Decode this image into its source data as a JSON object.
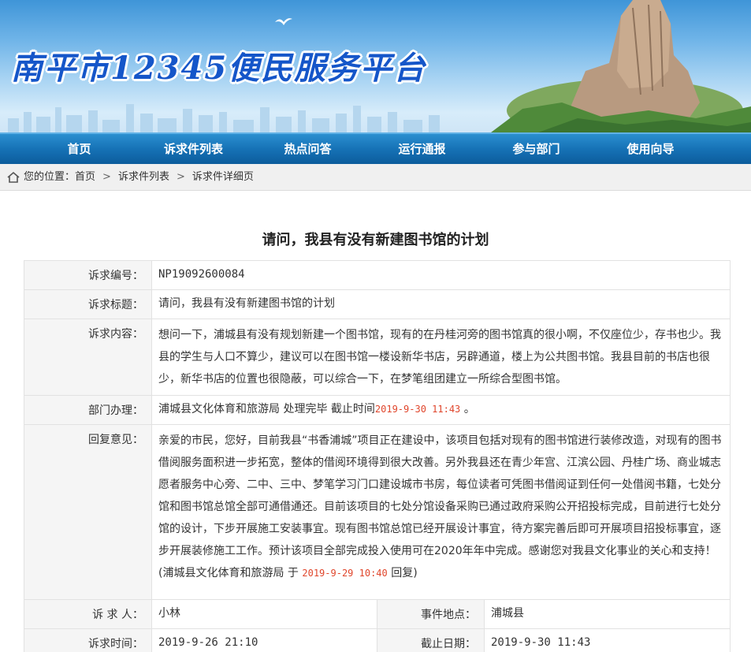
{
  "header": {
    "site_title": "南平市12345便民服务平台"
  },
  "nav": {
    "items": [
      {
        "label": "首页"
      },
      {
        "label": "诉求件列表"
      },
      {
        "label": "热点问答"
      },
      {
        "label": "运行通报"
      },
      {
        "label": "参与部门"
      },
      {
        "label": "使用向导"
      }
    ]
  },
  "breadcrumb": {
    "prefix": "您的位置：",
    "items": [
      "首页",
      "诉求件列表",
      "诉求件详细页"
    ],
    "separator": ">"
  },
  "page": {
    "title": "请问，我县有没有新建图书馆的计划"
  },
  "detail": {
    "id_label": "诉求编号：",
    "id_value": "NP19092600084",
    "title_label": "诉求标题：",
    "title_value": "请问，我县有没有新建图书馆的计划",
    "content_label": "诉求内容：",
    "content_value": "想问一下，浦城县有没有规划新建一个图书馆，现有的在丹桂河旁的图书馆真的很小啊，不仅座位少，存书也少。我县的学生与人口不算少，建议可以在图书馆一楼设新华书店，另辟通道，楼上为公共图书馆。我县目前的书店也很少，新华书店的位置也很隐蔽，可以综合一下，在梦笔组团建立一所综合型图书馆。",
    "dept_label": "部门办理：",
    "dept_prefix": "浦城县文化体育和旅游局 处理完毕  截止时间",
    "dept_deadline": "2019-9-30 11:43",
    "dept_suffix": " 。",
    "reply_label": "回复意见：",
    "reply_value": "亲爱的市民，您好，目前我县“书香浦城”项目正在建设中，该项目包括对现有的图书馆进行装修改造，对现有的图书借阅服务面积进一步拓宽，整体的借阅环境得到很大改善。另外我县还在青少年宫、江滨公园、丹桂广场、商业城志愿者服务中心旁、二中、三中、梦笔学习门口建设城市书房，每位读者可凭图书借阅证到任何一处借阅书籍，七处分馆和图书馆总馆全部可通借通还。目前该项目的七处分馆设备采购已通过政府采购公开招投标完成，目前进行七处分馆的设计，下步开展施工安装事宜。现有图书馆总馆已经开展设计事宜，待方案完善后即可开展项目招投标事宜，逐步开展装修施工工作。预计该项目全部完成投入使用可在2020年年中完成。感谢您对我县文化事业的关心和支持！",
    "reply_sign_prefix": "(浦城县文化体育和旅游局 于 ",
    "reply_sign_time": "2019-9-29 10:40",
    "reply_sign_suffix": " 回复)",
    "petitioner_label": "诉 求 人：",
    "petitioner_value": "小林",
    "location_label": "事件地点：",
    "location_value": "浦城县",
    "time_label": "诉求时间：",
    "time_value": "2019-9-26 21:10",
    "deadline_label": "截止日期：",
    "deadline_value": "2019-9-30 11:43"
  },
  "colors": {
    "nav_bg": "#1672b6",
    "title_blue": "#1556c9",
    "highlight_red": "#e0462c"
  }
}
